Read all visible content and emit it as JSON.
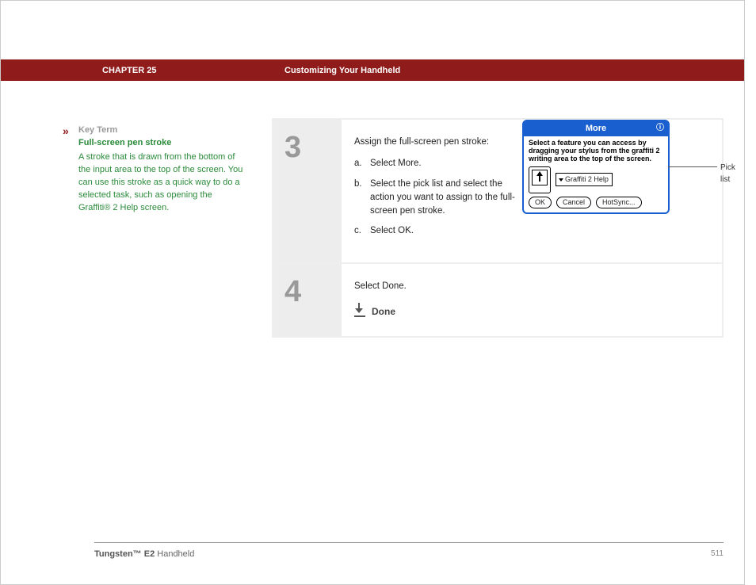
{
  "header": {
    "chapter_label": "CHAPTER 25",
    "chapter_title": "Customizing Your Handheld"
  },
  "sidebar": {
    "marker": "»",
    "label": "Key Term",
    "term": "Full-screen pen stroke",
    "definition": "A stroke that is drawn from the bottom of the input area to the top of the screen. You can use this stroke as a quick way to do a selected task, such as opening the Graffiti® 2 Help screen."
  },
  "steps": [
    {
      "num": "3",
      "intro": "Assign the full-screen pen stroke:",
      "items": [
        {
          "marker": "a.",
          "text": "Select More."
        },
        {
          "marker": "b.",
          "text": "Select the pick list and select the action you want to assign to the full-screen pen stroke."
        },
        {
          "marker": "c.",
          "text": "Select OK."
        }
      ]
    },
    {
      "num": "4",
      "intro": "Select Done.",
      "done_label": "Done"
    }
  ],
  "dialog": {
    "title": "More",
    "info_glyph": "ⓘ",
    "body_text": "Select a feature you can access by dragging your stylus from the graffiti 2 writing area to the top of the screen.",
    "picklist_value": "Graffiti 2 Help",
    "buttons": {
      "ok": "OK",
      "cancel": "Cancel",
      "hotsync": "HotSync..."
    },
    "callout": "Pick list"
  },
  "footer": {
    "product_bold": "Tungsten™ E2",
    "product_rest": " Handheld",
    "page": "511"
  }
}
